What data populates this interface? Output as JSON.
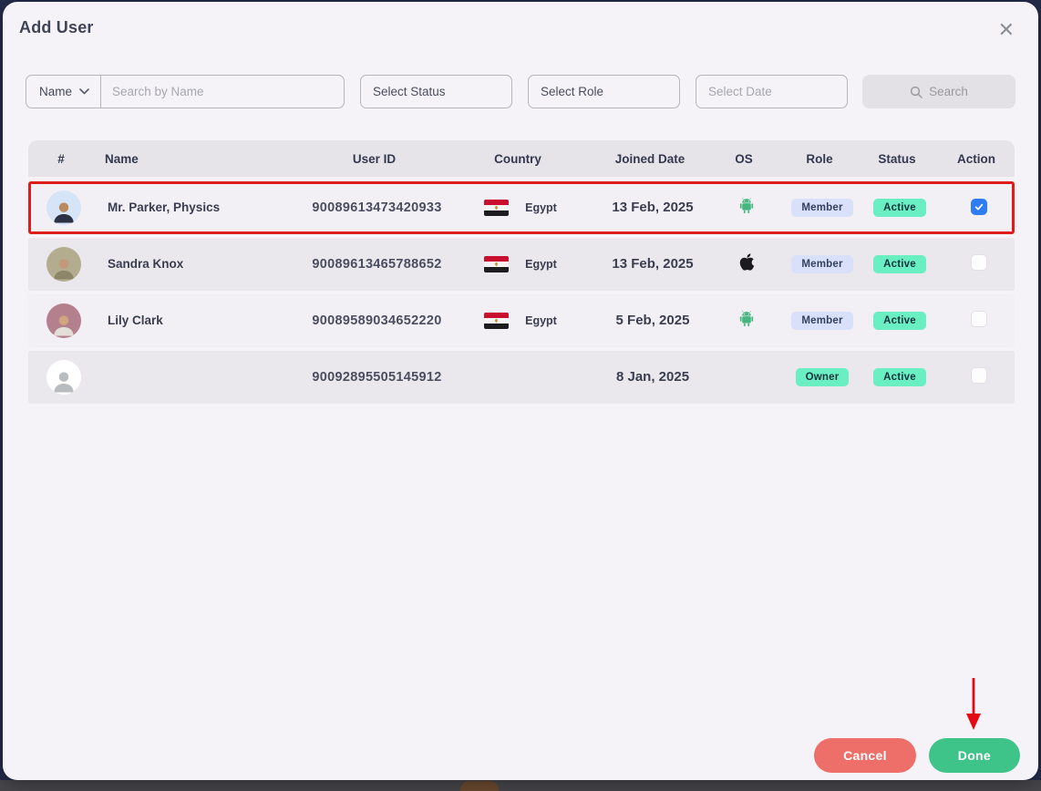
{
  "modal": {
    "title": "Add User",
    "close_icon": "✕"
  },
  "filters": {
    "name_dropdown": {
      "label": "Name"
    },
    "search_input": {
      "placeholder": "Search by Name"
    },
    "status_select": {
      "value": "Select Status"
    },
    "role_select": {
      "value": "Select Role"
    },
    "date_select": {
      "placeholder": "Select Date"
    },
    "search_button": {
      "label": "Search"
    }
  },
  "table": {
    "headers": [
      "#",
      "Name",
      "User ID",
      "Country",
      "Joined Date",
      "OS",
      "Role",
      "Status",
      "Action"
    ],
    "rows": [
      {
        "name": "Mr. Parker, Physics",
        "user_id": "90089613473420933",
        "country": "Egypt",
        "joined_date": "13 Feb, 2025",
        "os": "android",
        "role": "Member",
        "status": "Active",
        "checked": true,
        "highlighted": true,
        "avatar": "male-professional"
      },
      {
        "name": "Sandra Knox",
        "user_id": "90089613465788652",
        "country": "Egypt",
        "joined_date": "13 Feb, 2025",
        "os": "apple",
        "role": "Member",
        "status": "Active",
        "checked": false,
        "highlighted": false,
        "avatar": "female-olive"
      },
      {
        "name": "Lily Clark",
        "user_id": "90089589034652220",
        "country": "Egypt",
        "joined_date": "5 Feb, 2025",
        "os": "android",
        "role": "Member",
        "status": "Active",
        "checked": false,
        "highlighted": false,
        "avatar": "female-blonde"
      },
      {
        "name": "",
        "user_id": "90092895505145912",
        "country": "",
        "joined_date": "8 Jan, 2025",
        "os": "",
        "role": "Owner",
        "status": "Active",
        "checked": false,
        "highlighted": false,
        "avatar": "placeholder"
      }
    ]
  },
  "footer": {
    "cancel_label": "Cancel",
    "done_label": "Done"
  },
  "colors": {
    "modal_bg": "#f5f3f7",
    "backdrop": "#232c4a",
    "highlight_red": "#e01d1d",
    "annotation_arrow_red": "#e50914",
    "checkbox_blue": "#2e7df6",
    "badge_lavender": "#d8e0fa",
    "badge_mint": "#69efc2",
    "cancel_red": "#ee6f6a",
    "done_green": "#3ec488",
    "android_green": "#45b67e",
    "apple_black": "#1b1b1f"
  }
}
